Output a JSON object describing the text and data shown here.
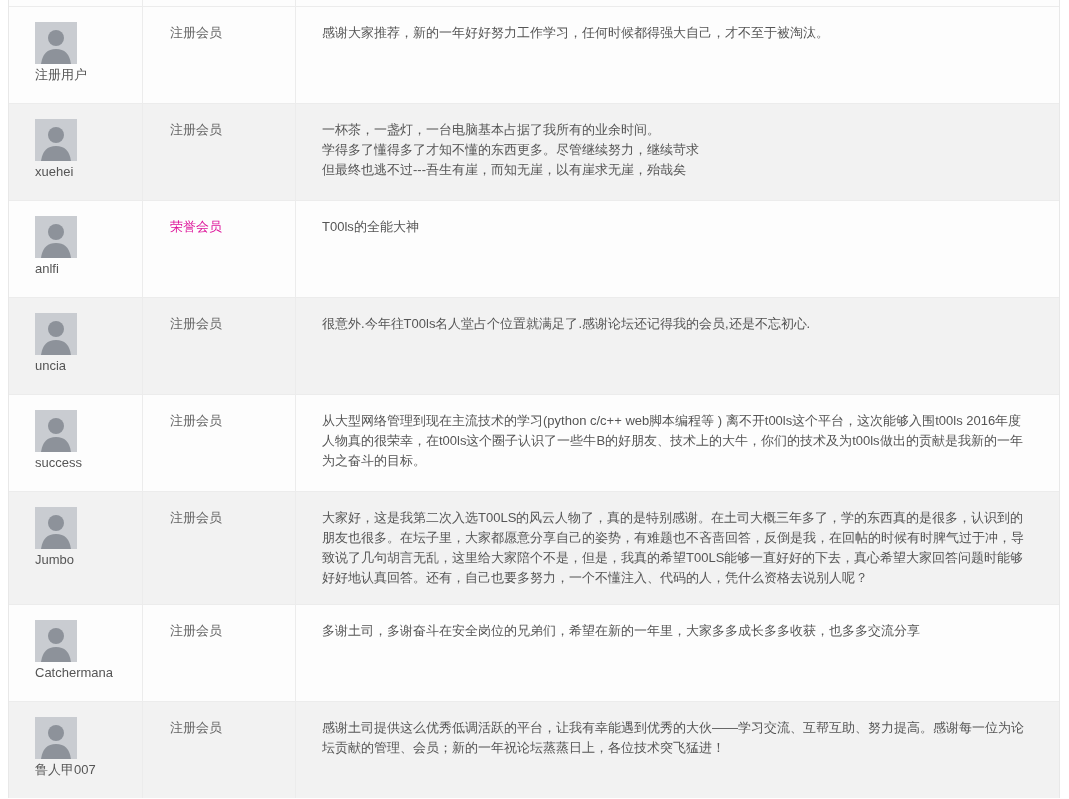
{
  "table": {
    "rows": [
      {
        "user": "注册用户",
        "member": {
          "label": "注册会员",
          "color": "#666666"
        },
        "message": [
          "感谢大家推荐，新的一年好好努力工作学习，任何时候都得强大自己，才不至于被淘汰。"
        ]
      },
      {
        "user": "xuehei",
        "member": {
          "label": "注册会员",
          "color": "#666666"
        },
        "message": [
          "一杯茶，一盏灯，一台电脑基本占据了我所有的业余时间。",
          "学得多了懂得多了才知不懂的东西更多。尽管继续努力，继续苛求",
          "但最终也逃不过---吾生有崖，而知无崖，以有崖求无崖，殆哉矣"
        ]
      },
      {
        "user": "anlfi",
        "member": {
          "label": "荣誉会员",
          "color": "#dd1199"
        },
        "message": [
          "T00ls的全能大神"
        ]
      },
      {
        "user": "uncia",
        "member": {
          "label": "注册会员",
          "color": "#666666"
        },
        "message": [
          "很意外.今年往T00ls名人堂占个位置就满足了.感谢论坛还记得我的会员,还是不忘初心."
        ]
      },
      {
        "user": "success",
        "member": {
          "label": "注册会员",
          "color": "#666666"
        },
        "message": [
          "从大型网络管理到现在主流技术的学习(python c/c++ web脚本编程等 ) 离不开t00ls这个平台，这次能够入围t00ls 2016年度人物真的很荣幸，在t00ls这个圈子认识了一些牛B的好朋友、技术上的大牛，你们的技术及为t00ls做出的贡献是我新的一年为之奋斗的目标。"
        ]
      },
      {
        "user": "Jumbo",
        "member": {
          "label": "注册会员",
          "color": "#666666"
        },
        "message": [
          "大家好，这是我第二次入选T00LS的风云人物了，真的是特别感谢。在土司大概三年多了，学的东西真的是很多，认识到的朋友也很多。在坛子里，大家都愿意分享自己的姿势，有难题也不吝啬回答，反倒是我，在回帖的时候有时脾气过于冲，导致说了几句胡言无乱，这里给大家陪个不是，但是，我真的希望T00LS能够一直好好的下去，真心希望大家回答问题时能够好好地认真回答。还有，自己也要多努力，一个不懂注入、代码的人，凭什么资格去说别人呢？"
        ]
      },
      {
        "user": "Catchermana",
        "member": {
          "label": "注册会员",
          "color": "#666666"
        },
        "message": [
          "多谢土司，多谢奋斗在安全岗位的兄弟们，希望在新的一年里，大家多多成长多多收获，也多多交流分享"
        ]
      },
      {
        "user": "鲁人甲007",
        "member": {
          "label": "注册会员",
          "color": "#666666"
        },
        "message": [
          "感谢土司提供这么优秀低调活跃的平台，让我有幸能遇到优秀的大伙——学习交流、互帮互助、努力提高。感谢每一位为论坛贡献的管理、会员；新的一年祝论坛蒸蒸日上，各位技术突飞猛进！"
        ]
      }
    ]
  }
}
